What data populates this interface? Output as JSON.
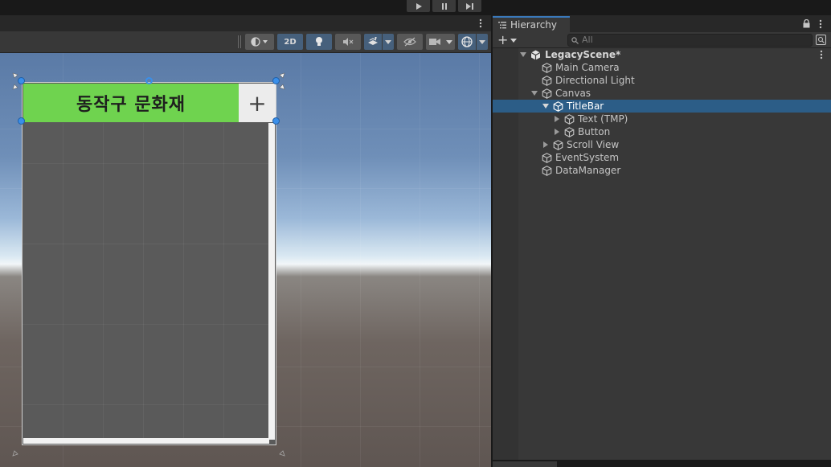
{
  "playbar": {
    "buttons": [
      "play-icon",
      "pause-icon",
      "step-icon"
    ]
  },
  "scene_toolbar": {
    "btn_2d": "2D"
  },
  "scene_view": {
    "title_bar_text": "동작구 문화재",
    "add_button_label": "+"
  },
  "hierarchy": {
    "tab_label": "Hierarchy",
    "search_placeholder": "All",
    "add_label": "+",
    "scene_name": "LegacyScene*",
    "items": [
      {
        "label": "Main Camera",
        "depth": 1,
        "expandable": false,
        "expanded": false,
        "selected": false
      },
      {
        "label": "Directional Light",
        "depth": 1,
        "expandable": false,
        "expanded": false,
        "selected": false
      },
      {
        "label": "Canvas",
        "depth": 1,
        "expandable": true,
        "expanded": true,
        "selected": false
      },
      {
        "label": "TitleBar",
        "depth": 2,
        "expandable": true,
        "expanded": true,
        "selected": true
      },
      {
        "label": "Text (TMP)",
        "depth": 3,
        "expandable": true,
        "expanded": false,
        "selected": false
      },
      {
        "label": "Button",
        "depth": 3,
        "expandable": true,
        "expanded": false,
        "selected": false
      },
      {
        "label": "Scroll View",
        "depth": 2,
        "expandable": true,
        "expanded": false,
        "selected": false
      },
      {
        "label": "EventSystem",
        "depth": 1,
        "expandable": false,
        "expanded": false,
        "selected": false
      },
      {
        "label": "DataManager",
        "depth": 1,
        "expandable": false,
        "expanded": false,
        "selected": false
      }
    ]
  },
  "colors": {
    "title_bar_green": "#6fd34f",
    "selection_blue": "#2c5d87",
    "handle_blue": "#3a8fea"
  }
}
